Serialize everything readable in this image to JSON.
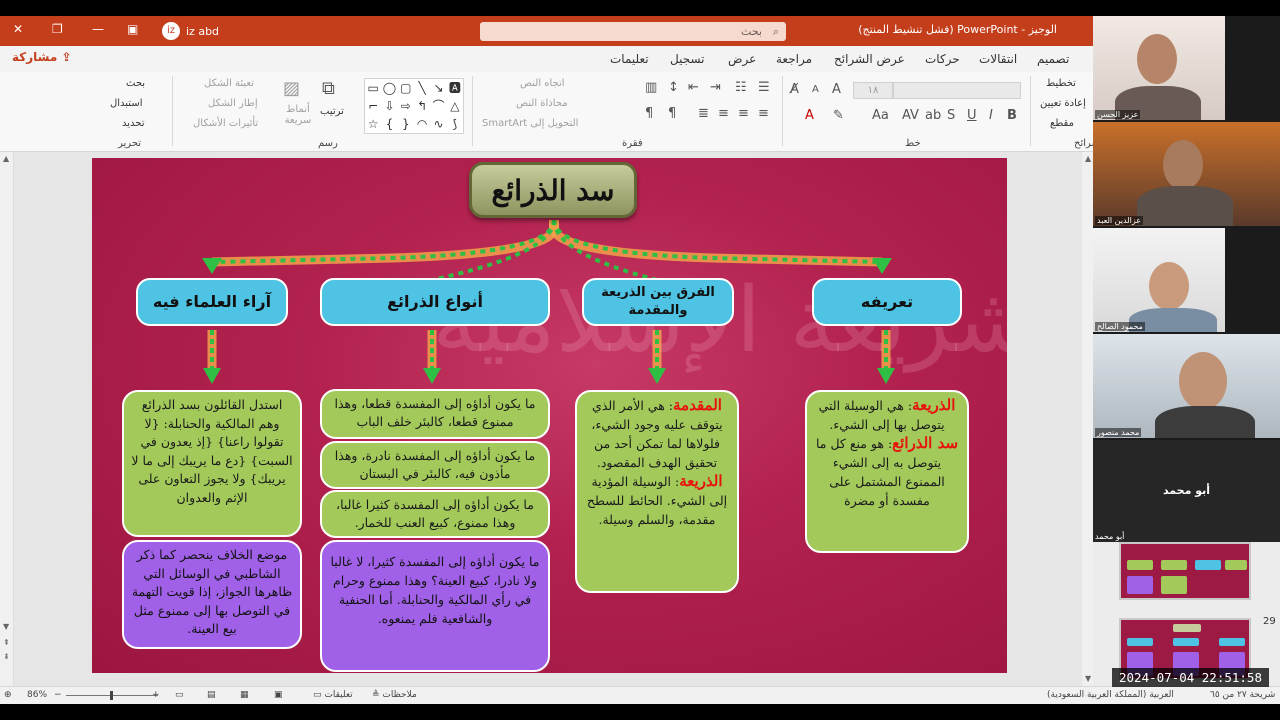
{
  "titlebar": {
    "doc_title": "الوجيز - PowerPoint (فشل تنشيط المنتج)",
    "search_placeholder": "بحث",
    "user_name": "iz abd",
    "user_initial": "iz"
  },
  "share_label": "مشاركة",
  "menu_tabs": [
    "تصميم",
    "انتقالات",
    "حركات",
    "عرض الشرائح",
    "مراجعة",
    "عرض",
    "تسجيل",
    "تعليمات"
  ],
  "ribbon": {
    "slides_group": {
      "layout": "تخطيط",
      "reset": "إعادة تعيين",
      "section": "مقطع",
      "label": "شرائح"
    },
    "font_group": {
      "label": "خط",
      "size": "١٨"
    },
    "paragraph_group": {
      "text_direction": "اتجاه النص",
      "align_text": "محاذاة النص",
      "smartart": "التحويل إلى SmartArt",
      "label": "فقرة"
    },
    "drawing_group": {
      "arrange": "ترتيب",
      "styles": "أنماط سريعة",
      "shape_fill": "تعبئة الشكل",
      "shape_outline": "إطار الشكل",
      "shape_effects": "تأثيرات الأشكال",
      "label": "رسم"
    },
    "editing_group": {
      "find": "بحث",
      "replace": "استبدال",
      "select": "تحديد",
      "label": "تحرير"
    }
  },
  "slide": {
    "title": "سد الذرائع",
    "watermark": "الشريعة الإسلامية",
    "categories": {
      "definition": "تعريفه",
      "difference": "الفرق بين الذريعة والمقدمة",
      "types": "أنواع الذرائع",
      "opinions": "آراء العلماء فيه"
    },
    "definition_card": {
      "term1": "الذريعة",
      "text1": ": هي الوسيلة التي يتوصل بها إلى الشيء.",
      "term2": "سد الذرائع",
      "text2": ": هو منع كل ما يتوصل به إلى الشيء الممنوع المشتمل على مفسدة أو مضرة"
    },
    "difference_card": {
      "term1": "المقدمة",
      "text1": ": هي الأمر الذي يتوقف عليه وجود الشيء، فلولاها لما تمكن أحد من تحقيق الهدف المقصود.",
      "term2": "الذريعة",
      "text2": ": الوسيلة المؤدية إلى الشيء. الحائط للسطح مقدمة، والسلم وسيلة."
    },
    "types_cards": [
      "ما يكون أداؤه إلى المفسدة قطعا، وهذا ممنوع قطعا، كالبئر خلف الباب",
      "ما يكون أداؤه إلى المفسدة نادرة، وهذا مأذون فيه، كالبئر في البستان",
      "ما يكون أداؤه إلى المفسدة كثيرا غالبا، وهذا ممنوع، كبيع العنب للخمار.",
      "ما يكون أداؤه إلى المفسدة كثيرا، لا غالبا ولا نادرا، كبيع العينة؟ وهذا ممنوع وحرام في رأي المالكية والحنابلة. أما الحنفية والشافعية فلم يمنعوه."
    ],
    "opinions_cards": [
      "استدل القائلون بسد الذرائع وهم المالكية والحنابلة: {لا تقولوا راعنا} {إذ يعدون في السبت} {دع ما يريبك إلى ما لا يريبك} ولا يجوز التعاون على الإثم والعدوان",
      "موضع الخلاف ينحصر كما ذكر الشاطبي في الوسائل التي ظاهرها الجواز، إذا قويت التهمة في التوصل بها إلى ممنوع مثل بيع العينة."
    ]
  },
  "statusbar": {
    "slide_info": "شريحة ٢٧ من ٦٥",
    "language": "العربية (المملكة العربية السعودية)",
    "notes": "ملاحظات",
    "comments": "تعليقات",
    "zoom": "86%"
  },
  "participants": [
    {
      "name": "عزيز الحسن"
    },
    {
      "name": "عزالدين العبد"
    },
    {
      "name": "محمود الصالح"
    },
    {
      "name": "محمد منصور"
    },
    {
      "name": "أبو محمد"
    }
  ],
  "name_tile_label": "أبو محمد",
  "thumb_number": "29",
  "timestamp": "2024-07-04  22:51:58",
  "colors": {
    "accent": "#c43e1c",
    "slide_bg": "#b3224f",
    "category": "#4fc3e3",
    "green_card": "#a2c95a",
    "purple_card": "#a061e8",
    "arrow": "#2fbf45"
  }
}
